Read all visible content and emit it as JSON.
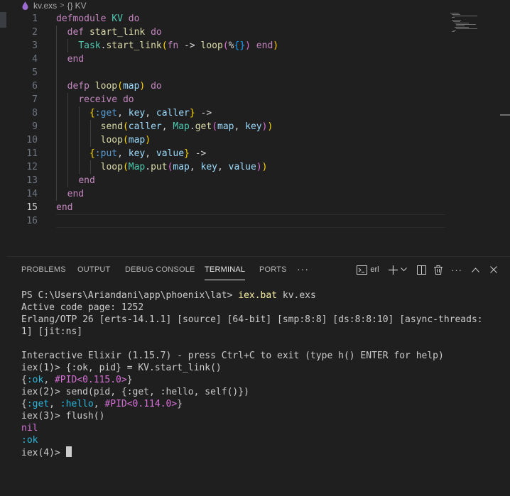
{
  "breadcrumb": {
    "file": "kv.exs",
    "symbol": "KV"
  },
  "editor": {
    "active_line": 15,
    "lines": [
      [
        {
          "t": "defmodule ",
          "c": "kw"
        },
        {
          "t": "KV ",
          "c": "mod"
        },
        {
          "t": "do",
          "c": "kw"
        }
      ],
      [
        {
          "t": "  "
        },
        {
          "t": "def ",
          "c": "kw"
        },
        {
          "t": "start_link ",
          "c": "fn"
        },
        {
          "t": "do",
          "c": "kw"
        }
      ],
      [
        {
          "t": "    "
        },
        {
          "t": "Task",
          "c": "mod"
        },
        {
          "t": ".",
          "c": "pl"
        },
        {
          "t": "start_link",
          "c": "fn"
        },
        {
          "t": "(",
          "c": "br1"
        },
        {
          "t": "fn ",
          "c": "kw"
        },
        {
          "t": "-> ",
          "c": "pl"
        },
        {
          "t": "loop",
          "c": "fn"
        },
        {
          "t": "(",
          "c": "br2"
        },
        {
          "t": "%",
          "c": "pl"
        },
        {
          "t": "{}",
          "c": "br3"
        },
        {
          "t": ")",
          "c": "br2"
        },
        {
          "t": " end",
          "c": "kw"
        },
        {
          "t": ")",
          "c": "br1"
        }
      ],
      [
        {
          "t": "  "
        },
        {
          "t": "end",
          "c": "kw"
        }
      ],
      [],
      [
        {
          "t": "  "
        },
        {
          "t": "defp ",
          "c": "kw"
        },
        {
          "t": "loop",
          "c": "fn"
        },
        {
          "t": "(",
          "c": "br1"
        },
        {
          "t": "map",
          "c": "var"
        },
        {
          "t": ")",
          "c": "br1"
        },
        {
          "t": " do",
          "c": "kw"
        }
      ],
      [
        {
          "t": "    "
        },
        {
          "t": "receive ",
          "c": "kw"
        },
        {
          "t": "do",
          "c": "kw"
        }
      ],
      [
        {
          "t": "      "
        },
        {
          "t": "{",
          "c": "br1"
        },
        {
          "t": ":get",
          "c": "atom"
        },
        {
          "t": ", ",
          "c": "pl"
        },
        {
          "t": "key",
          "c": "var"
        },
        {
          "t": ", ",
          "c": "pl"
        },
        {
          "t": "caller",
          "c": "var"
        },
        {
          "t": "}",
          "c": "br1"
        },
        {
          "t": " ->",
          "c": "pl"
        }
      ],
      [
        {
          "t": "        "
        },
        {
          "t": "send",
          "c": "fn"
        },
        {
          "t": "(",
          "c": "br1"
        },
        {
          "t": "caller",
          "c": "var"
        },
        {
          "t": ", ",
          "c": "pl"
        },
        {
          "t": "Map",
          "c": "mod"
        },
        {
          "t": ".",
          "c": "pl"
        },
        {
          "t": "get",
          "c": "fn"
        },
        {
          "t": "(",
          "c": "br2"
        },
        {
          "t": "map",
          "c": "var"
        },
        {
          "t": ", ",
          "c": "pl"
        },
        {
          "t": "key",
          "c": "var"
        },
        {
          "t": ")",
          "c": "br2"
        },
        {
          "t": ")",
          "c": "br1"
        }
      ],
      [
        {
          "t": "        "
        },
        {
          "t": "loop",
          "c": "fn"
        },
        {
          "t": "(",
          "c": "br1"
        },
        {
          "t": "map",
          "c": "var"
        },
        {
          "t": ")",
          "c": "br1"
        }
      ],
      [
        {
          "t": "      "
        },
        {
          "t": "{",
          "c": "br1"
        },
        {
          "t": ":put",
          "c": "atom"
        },
        {
          "t": ", ",
          "c": "pl"
        },
        {
          "t": "key",
          "c": "var"
        },
        {
          "t": ", ",
          "c": "pl"
        },
        {
          "t": "value",
          "c": "var"
        },
        {
          "t": "}",
          "c": "br1"
        },
        {
          "t": " ->",
          "c": "pl"
        }
      ],
      [
        {
          "t": "        "
        },
        {
          "t": "loop",
          "c": "fn"
        },
        {
          "t": "(",
          "c": "br1"
        },
        {
          "t": "Map",
          "c": "mod"
        },
        {
          "t": ".",
          "c": "pl"
        },
        {
          "t": "put",
          "c": "fn"
        },
        {
          "t": "(",
          "c": "br2"
        },
        {
          "t": "map",
          "c": "var"
        },
        {
          "t": ", ",
          "c": "pl"
        },
        {
          "t": "key",
          "c": "var"
        },
        {
          "t": ", ",
          "c": "pl"
        },
        {
          "t": "value",
          "c": "var"
        },
        {
          "t": ")",
          "c": "br2"
        },
        {
          "t": ")",
          "c": "br1"
        }
      ],
      [
        {
          "t": "    "
        },
        {
          "t": "end",
          "c": "kw"
        }
      ],
      [
        {
          "t": "  "
        },
        {
          "t": "end",
          "c": "kw"
        }
      ],
      [
        {
          "t": "end",
          "c": "kw"
        }
      ],
      []
    ]
  },
  "panel": {
    "tabs": [
      "PROBLEMS",
      "OUTPUT",
      "DEBUG CONSOLE",
      "TERMINAL",
      "PORTS"
    ],
    "active_tab": "TERMINAL",
    "terminal_profile": "erl"
  },
  "terminal": {
    "lines": [
      [
        {
          "t": "PS C:\\Users\\Ariandani\\app\\phoenix\\lat> "
        },
        {
          "t": "iex.bat",
          "c": "t-yel"
        },
        {
          "t": " kv.exs"
        }
      ],
      [
        {
          "t": "Active code page: 1252"
        }
      ],
      [
        {
          "t": "Erlang/OTP 26 [erts-14.1.1] [source] [64-bit] [smp:8:8] [ds:8:8:10] [async-threads:"
        }
      ],
      [
        {
          "t": "1] [jit:ns]"
        }
      ],
      [],
      [
        {
          "t": "Interactive Elixir (1.15.7) - press Ctrl+C to exit (type h() ENTER for help)"
        }
      ],
      [
        {
          "t": "iex(1)> {:ok, pid} = KV.start_link()"
        }
      ],
      [
        {
          "t": "{",
          "c": "t-grey"
        },
        {
          "t": ":ok",
          "c": "t-cyan"
        },
        {
          "t": ", "
        },
        {
          "t": "#PID<0.115.0>",
          "c": "t-mag"
        },
        {
          "t": "}"
        }
      ],
      [
        {
          "t": "iex(2)> send(pid, {:get, :hello, self()})"
        }
      ],
      [
        {
          "t": "{"
        },
        {
          "t": ":get",
          "c": "t-cyan"
        },
        {
          "t": ", "
        },
        {
          "t": ":hello",
          "c": "t-cyan"
        },
        {
          "t": ", "
        },
        {
          "t": "#PID<0.114.0>",
          "c": "t-mag"
        },
        {
          "t": "}"
        }
      ],
      [
        {
          "t": "iex(3)> flush()"
        }
      ],
      [
        {
          "t": "nil",
          "c": "t-mag"
        }
      ],
      [
        {
          "t": ":ok",
          "c": "t-cyan"
        }
      ],
      [
        {
          "t": "iex(4)> "
        }
      ]
    ]
  },
  "colors": {
    "background": "#1f1f1f",
    "keyword": "#c586c0",
    "module": "#4ec9b0",
    "function": "#dcdcaa",
    "variable": "#9cdcfe",
    "atom": "#569cd6"
  }
}
